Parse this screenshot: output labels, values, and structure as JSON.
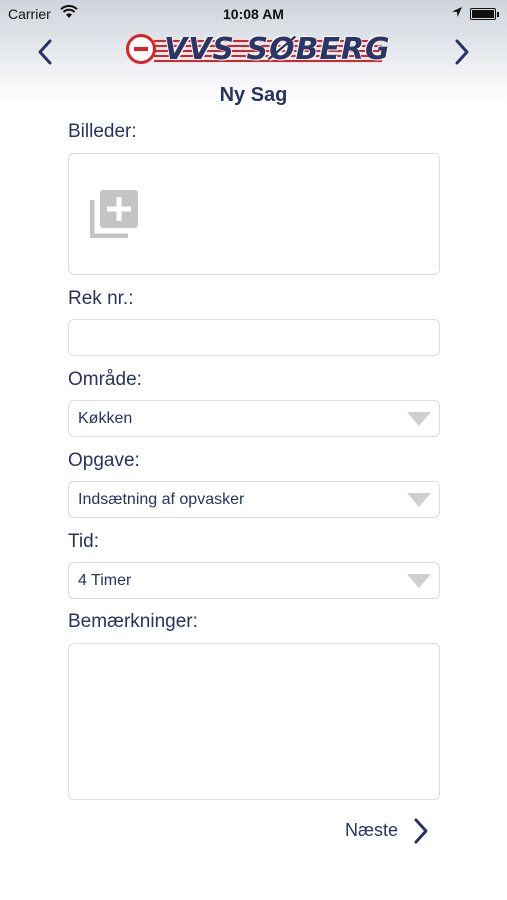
{
  "status": {
    "carrier": "Carrier",
    "time": "10:08 AM"
  },
  "header": {
    "logo_text": "VVS SØBERG",
    "title": "Ny Sag"
  },
  "form": {
    "billeder_label": "Billeder:",
    "rek_label": "Rek nr.:",
    "rek_value": "",
    "omraade_label": "Område:",
    "omraade_value": "Køkken",
    "opgave_label": "Opgave:",
    "opgave_value": "Indsætning af opvasker",
    "tid_label": "Tid:",
    "tid_value": "4 Timer",
    "bemaerk_label": "Bemærkninger:",
    "bemaerk_value": ""
  },
  "footer": {
    "next_label": "Næste"
  },
  "colors": {
    "accent_navy": "#2b3163",
    "brand_red": "#d8232a",
    "border": "#dcdcdc"
  },
  "icons": {
    "back": "chevron-left-icon",
    "forward": "chevron-right-icon",
    "add_photo": "add-photo-icon",
    "dropdown": "triangle-down-icon"
  }
}
